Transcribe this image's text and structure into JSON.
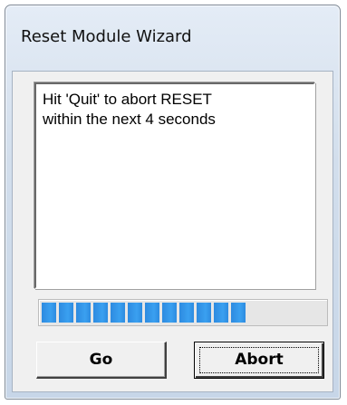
{
  "window": {
    "title": "Reset Module Wizard"
  },
  "message": {
    "lines": [
      "Hit 'Quit' to abort RESET",
      "within the next 4 seconds"
    ]
  },
  "progress": {
    "value_percent": 72
  },
  "buttons": {
    "go_label": "Go",
    "abort_label": "Abort"
  },
  "colors": {
    "progress_fill": "#2d8be0",
    "window_frame": "#d2deec",
    "client_background": "#f0f0f0"
  }
}
